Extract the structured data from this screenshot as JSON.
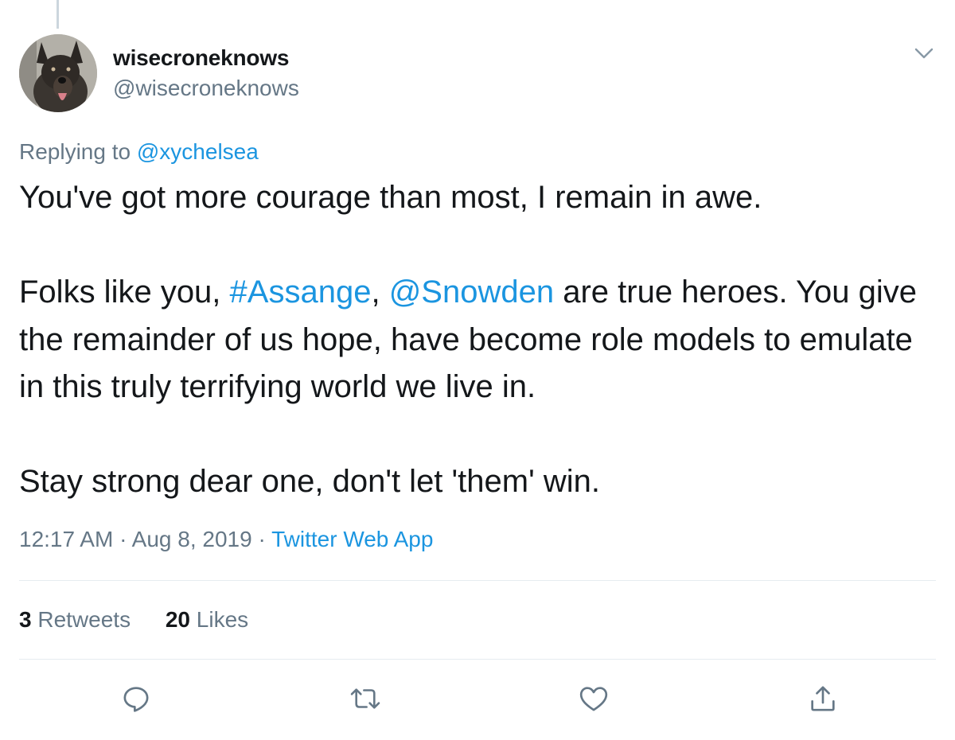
{
  "author": {
    "display_name": "wisecroneknows",
    "handle": "@wisecroneknows",
    "avatar_icon": "dog-avatar"
  },
  "reply": {
    "prefix": "Replying to ",
    "to": "@xychelsea"
  },
  "tweet": {
    "line1": "You've got more courage than most, I remain in awe.",
    "p2_start": "Folks like you, ",
    "hashtag": "#Assange",
    "sep": ", ",
    "mention": "@Snowden",
    "p2_rest": " are true heroes.  You give the remainder of us hope, have become role models to emulate in this truly terrifying world we live in.",
    "line3": "Stay strong dear one, don't let 'them' win."
  },
  "meta": {
    "time": "12:17 AM",
    "dot1": " · ",
    "date": "Aug 8, 2019",
    "dot2": " · ",
    "source": "Twitter Web App"
  },
  "stats": {
    "retweets_count": "3",
    "retweets_label": " Retweets",
    "likes_count": "20",
    "likes_label": " Likes"
  },
  "actions": [
    "reply-icon",
    "retweet-icon",
    "like-icon",
    "share-icon"
  ],
  "colors": {
    "link": "#1b95e0",
    "secondary_text": "#657786",
    "primary_text": "#14171a",
    "divider": "#e6ecf0"
  }
}
